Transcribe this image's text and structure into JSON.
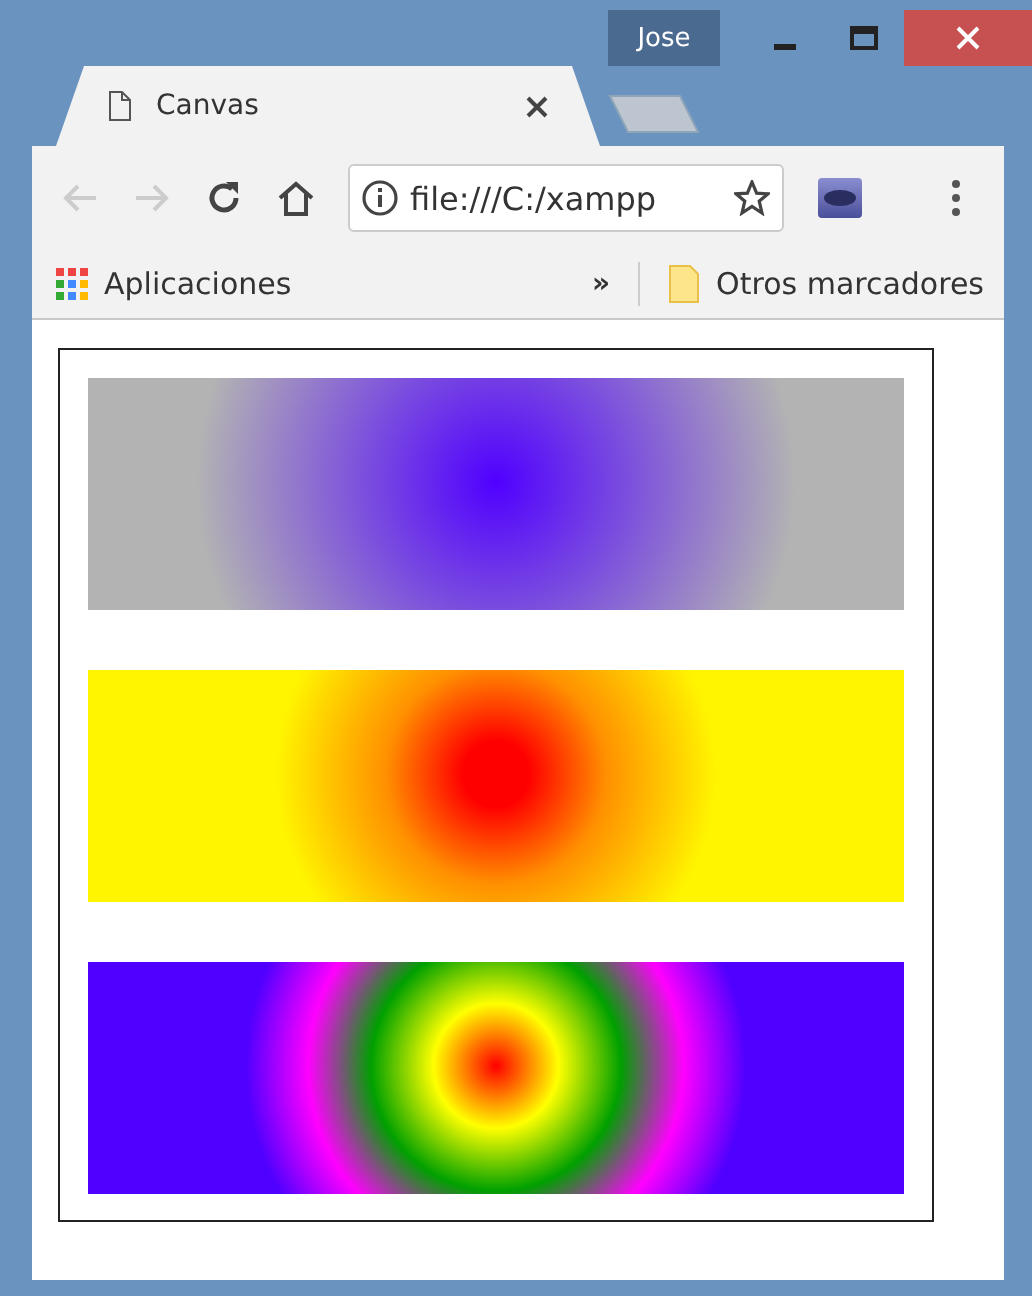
{
  "window": {
    "profile": "Jose"
  },
  "tabs": [
    {
      "title": "Canvas",
      "selected": true
    }
  ],
  "toolbar": {
    "address": "file:///C:/xampp"
  },
  "bookmarks": {
    "apps": "Aplicaciones",
    "overflow": "»",
    "other": "Otros marcadores"
  }
}
